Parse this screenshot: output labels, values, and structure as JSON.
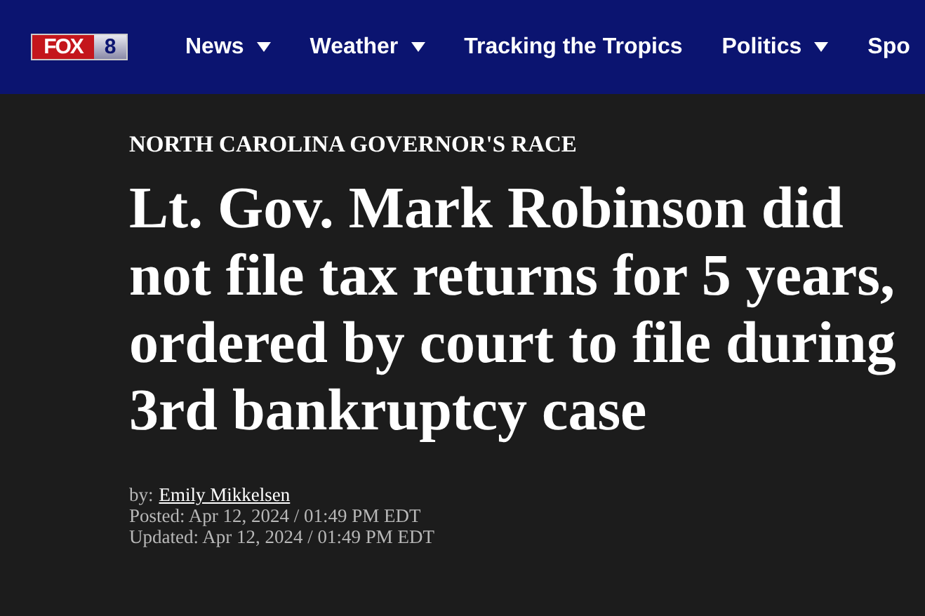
{
  "header": {
    "logo": {
      "word": "FOX",
      "number": "8"
    },
    "nav": [
      {
        "label": "News",
        "has_menu": true
      },
      {
        "label": "Weather",
        "has_menu": true
      },
      {
        "label": "Tracking the Tropics",
        "has_menu": false
      },
      {
        "label": "Politics",
        "has_menu": true
      },
      {
        "label": "Spo",
        "has_menu": false
      }
    ]
  },
  "article": {
    "kicker": "NORTH CAROLINA GOVERNOR'S RACE",
    "headline": "Lt. Gov. Mark Robinson did not file tax returns for 5 years, ordered by court to file during 3rd bankruptcy case",
    "byline": {
      "prefix": "by:",
      "author": "Emily Mikkelsen"
    },
    "posted": "Posted: Apr 12, 2024 / 01:49 PM EDT",
    "updated": "Updated: Apr 12, 2024 / 01:49 PM EDT"
  }
}
